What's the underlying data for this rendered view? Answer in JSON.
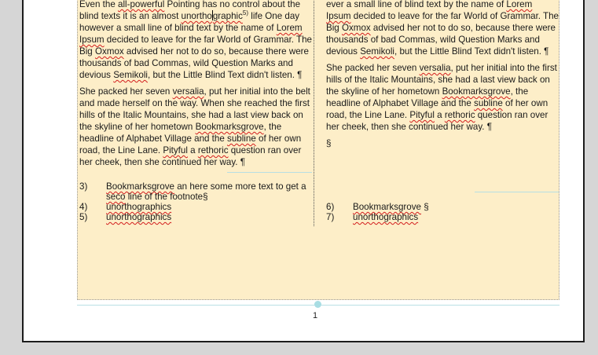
{
  "col1": {
    "p1": {
      "a": "Even the ",
      "b": "all-powerful",
      "c": " Pointing has no control about the blind texts it is an almost ",
      "d1": "unortho",
      "d2": "graphic",
      "fnref": "5)",
      "e": " life One day however a small line of blind text by the name of ",
      "f": "Lorem Ipsum",
      "g": " decided to leave for the far World of Grammar. The Big ",
      "h": "Oxmox",
      "i": " advised her not to do so, because there were thousands of bad Commas, wild Question Marks and devious ",
      "j": "Semikoli",
      "k": ", but the Little Blind Text didn't listen. ¶"
    },
    "p2": {
      "a": "She packed her seven ",
      "b": "versalia",
      "c": ", put her initial into the belt and made herself on the way. When she reached the first hills of the Italic Mountains, she had a last view back on the skyline of her hometown ",
      "d": "Bookmarksgrove",
      "e": ", the headline of Alphabet Village and the ",
      "f": "subline",
      "g": " of her own road, the Line Lane. ",
      "h": "Pityful",
      "i": " a ",
      "j": "rethoric",
      "k": " question ran over her cheek, then she continued her way. ¶"
    }
  },
  "col2": {
    "p1": {
      "a": "ever a small line of blind text by the name of ",
      "b": "Lorem Ipsum",
      "c": " decided to leave for the far World of Grammar. The Big ",
      "d": "Oxmox",
      "e": " advised her not to do so, because there were thousands of bad Commas, wild Question Marks and devious ",
      "f": "Semikoli",
      "g": ", but the Little Blind Text didn't listen. ¶"
    },
    "p2": {
      "a": "She packed her seven ",
      "b": "versalia",
      "c": ", put her initial into the first hills of the Italic Mountains, she had a last view back on the skyline of her hometown ",
      "d": "Bookmarksgrove",
      "e": ", the headline of Alphabet Village and the ",
      "f": "subline",
      "g": " of her own road, the Line Lane. ",
      "h": "Pityful",
      "i": " a ",
      "j": "rethoric",
      "k": " question ran over her cheek, then she continued her way. ¶"
    },
    "section_mark": "§"
  },
  "footnotes_col1": [
    {
      "num": "3)",
      "sq1": "Bookmarksgrove",
      "t1": " an here some more text to get a",
      "sq2": "seco",
      "t2": " line of the footnote§"
    },
    {
      "num": "4)",
      "sq1": "unorthographics"
    },
    {
      "num": "5)",
      "sq1": "unorthographics"
    }
  ],
  "footnotes_col2": [
    {
      "num": "6)",
      "sq1": "Bookmarksgrove",
      "t1": " §"
    },
    {
      "num": "7)",
      "sq1": "unorthographics"
    }
  ],
  "page_number": "1"
}
